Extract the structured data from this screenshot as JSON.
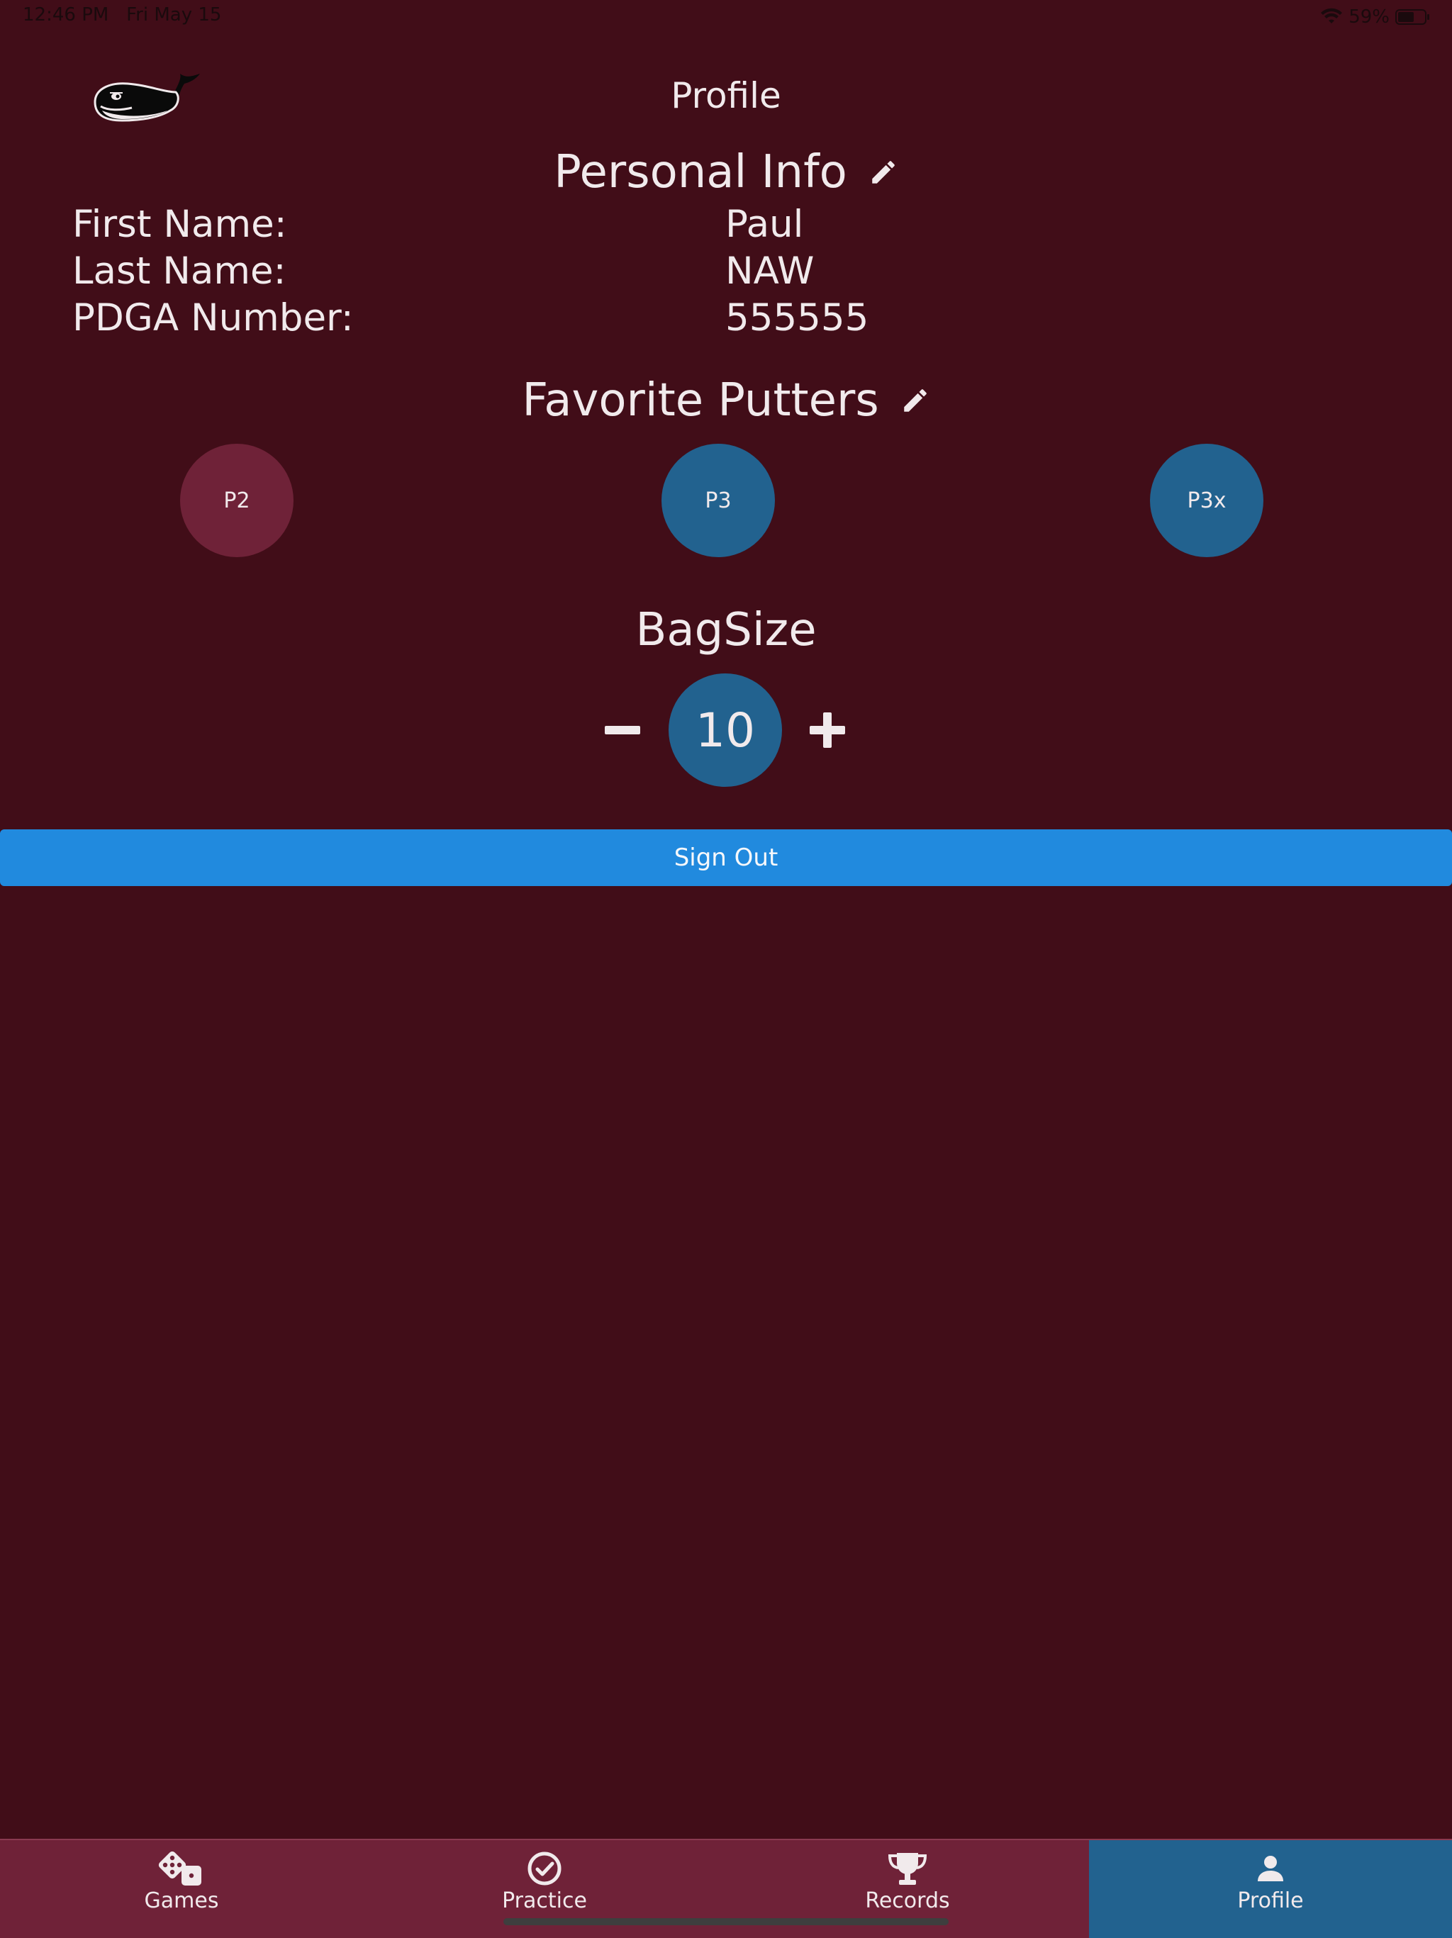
{
  "status_bar": {
    "time": "12:46 PM   Fri May 15",
    "battery": "59%",
    "icons": [
      "wifi-icon",
      "battery-icon"
    ]
  },
  "header": {
    "title": "Profile",
    "logo_icon": "whale-logo-icon"
  },
  "personal_info": {
    "title": "Personal Info",
    "edit_icon": "pencil-icon",
    "rows": [
      {
        "label": "First Name:",
        "value": "Paul"
      },
      {
        "label": "Last Name:",
        "value": "NAW"
      },
      {
        "label": "PDGA Number:",
        "value": "555555"
      }
    ]
  },
  "favorite_putters": {
    "title": "Favorite Putters",
    "edit_icon": "pencil-icon",
    "items": [
      {
        "label": "P2",
        "selected": false
      },
      {
        "label": "P3",
        "selected": true
      },
      {
        "label": "P3x",
        "selected": true
      }
    ]
  },
  "bag_size": {
    "title": "BagSize",
    "value": "10",
    "decrement_icon": "minus-icon",
    "increment_icon": "plus-icon"
  },
  "sign_out": {
    "label": "Sign Out"
  },
  "tab_bar": {
    "tabs": [
      {
        "label": "Games",
        "icon": "dice-icon",
        "active": false
      },
      {
        "label": "Practice",
        "icon": "check-circle-icon",
        "active": false
      },
      {
        "label": "Records",
        "icon": "trophy-icon",
        "active": false
      },
      {
        "label": "Profile",
        "icon": "person-icon",
        "active": true
      }
    ]
  },
  "colors": {
    "background": "#410d18",
    "accent_blue": "#22628f",
    "unselected_maroon": "#6f2238",
    "button_blue": "#218ade",
    "text": "#f1eaec"
  }
}
